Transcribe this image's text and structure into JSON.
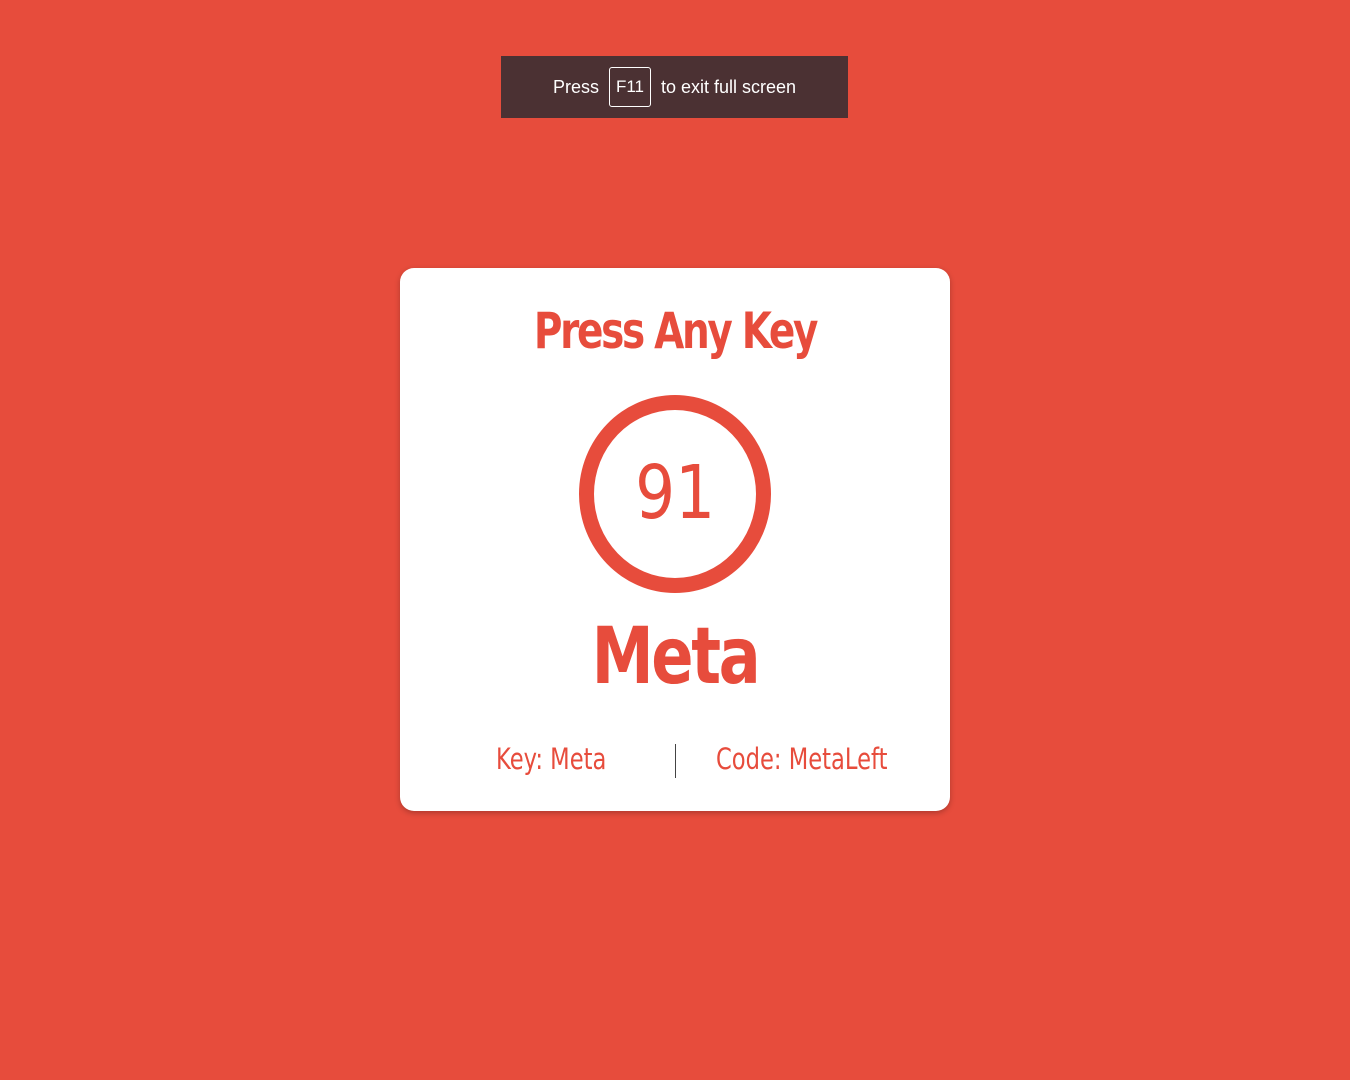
{
  "fullscreen_notice": {
    "prefix": "Press",
    "key": "F11",
    "suffix": "to exit full screen"
  },
  "card": {
    "title": "Press Any Key",
    "key_code": "91",
    "key_name": "Meta",
    "key_label": "Key: Meta",
    "code_label": "Code: MetaLeft"
  },
  "colors": {
    "background": "#e74c3c",
    "accent": "#e74c3c",
    "card": "#ffffff",
    "banner": "#4b3133"
  }
}
